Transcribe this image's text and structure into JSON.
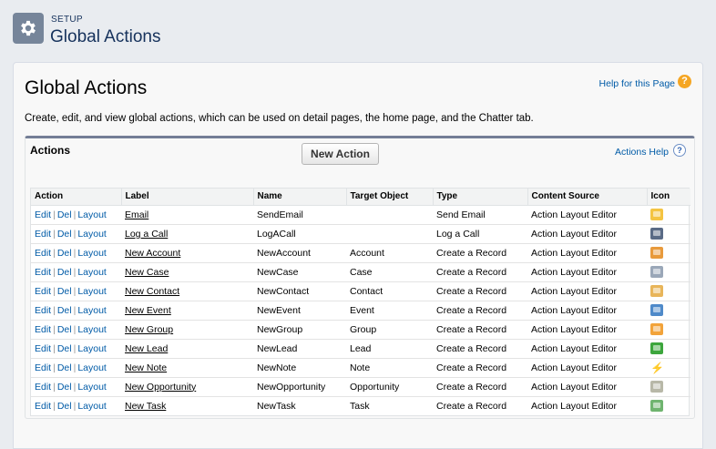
{
  "header": {
    "eyebrow": "SETUP",
    "title": "Global Actions"
  },
  "page": {
    "title": "Global Actions",
    "help_link": "Help for this Page",
    "description": "Create, edit, and view global actions, which can be used on detail pages, the home page, and the Chatter tab."
  },
  "actions": {
    "title": "Actions",
    "new_button": "New Action",
    "help_link": "Actions Help",
    "columns": [
      "Action",
      "Label",
      "Name",
      "Target Object",
      "Type",
      "Content Source",
      "Icon"
    ],
    "row_links": {
      "edit": "Edit",
      "del": "Del",
      "layout": "Layout"
    },
    "rows": [
      {
        "label": "Email",
        "name": "SendEmail",
        "target": "",
        "type": "Send Email",
        "source": "Action Layout Editor",
        "icon": "email-icon",
        "icon_color": "#f4c442"
      },
      {
        "label": "Log a Call",
        "name": "LogACall",
        "target": "",
        "type": "Log a Call",
        "source": "Action Layout Editor",
        "icon": "phone-icon",
        "icon_color": "#5a6b86"
      },
      {
        "label": "New Account",
        "name": "NewAccount",
        "target": "Account",
        "type": "Create a Record",
        "source": "Action Layout Editor",
        "icon": "account-icon",
        "icon_color": "#e89a3c"
      },
      {
        "label": "New Case",
        "name": "NewCase",
        "target": "Case",
        "type": "Create a Record",
        "source": "Action Layout Editor",
        "icon": "case-icon",
        "icon_color": "#9aa7b8"
      },
      {
        "label": "New Contact",
        "name": "NewContact",
        "target": "Contact",
        "type": "Create a Record",
        "source": "Action Layout Editor",
        "icon": "contact-icon",
        "icon_color": "#e8b55a"
      },
      {
        "label": "New Event",
        "name": "NewEvent",
        "target": "Event",
        "type": "Create a Record",
        "source": "Action Layout Editor",
        "icon": "event-icon",
        "icon_color": "#4f8ac9"
      },
      {
        "label": "New Group",
        "name": "NewGroup",
        "target": "Group",
        "type": "Create a Record",
        "source": "Action Layout Editor",
        "icon": "group-icon",
        "icon_color": "#f2a33a"
      },
      {
        "label": "New Lead",
        "name": "NewLead",
        "target": "Lead",
        "type": "Create a Record",
        "source": "Action Layout Editor",
        "icon": "lead-icon",
        "icon_color": "#3da63d"
      },
      {
        "label": "New Note",
        "name": "NewNote",
        "target": "Note",
        "type": "Create a Record",
        "source": "Action Layout Editor",
        "icon": "note-icon",
        "icon_color": "#000000"
      },
      {
        "label": "New Opportunity",
        "name": "NewOpportunity",
        "target": "Opportunity",
        "type": "Create a Record",
        "source": "Action Layout Editor",
        "icon": "opportunity-icon",
        "icon_color": "#b8b8a8"
      },
      {
        "label": "New Task",
        "name": "NewTask",
        "target": "Task",
        "type": "Create a Record",
        "source": "Action Layout Editor",
        "icon": "task-icon",
        "icon_color": "#6fb46f"
      }
    ]
  },
  "colors": {
    "link": "#015ba7",
    "header_text": "#16325c",
    "block_top_border": "#747e96"
  }
}
